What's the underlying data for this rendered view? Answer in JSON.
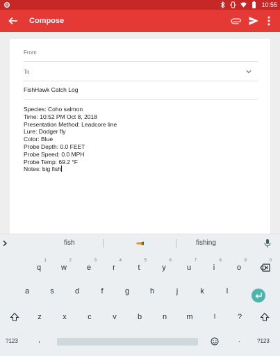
{
  "status_bar": {
    "time": "10:55",
    "icons": [
      "settings-icon",
      "bluetooth-icon",
      "vibrate-icon",
      "wifi-icon",
      "battery-icon"
    ]
  },
  "app_bar": {
    "title": "Compose",
    "icons": [
      "back-arrow-icon",
      "paperclip-icon",
      "send-icon",
      "more-vert-icon"
    ]
  },
  "compose": {
    "from_label": "From",
    "to_label": "To",
    "subject": "FishHawk Catch Log",
    "body_lines": [
      "Species: Coho salmon",
      "Time: 10:52 PM Oct 8, 2018",
      "Presentation Method: Leadcore line",
      "Lure: Dodger fly",
      "Color: Blue",
      "Probe Depth: 0.0 FEET",
      "Probe Speed: 0.0 MPH",
      "Probe Temp: 69.2 °F",
      "Notes: big fish"
    ]
  },
  "suggestions": {
    "left": "fish",
    "right": "fishing"
  },
  "keyboard": {
    "row1": [
      {
        "label": "q",
        "hint": "1"
      },
      {
        "label": "w",
        "hint": "2"
      },
      {
        "label": "e",
        "hint": "3"
      },
      {
        "label": "r",
        "hint": "4"
      },
      {
        "label": "t",
        "hint": "5"
      },
      {
        "label": "y",
        "hint": "6"
      },
      {
        "label": "u",
        "hint": "7"
      },
      {
        "label": "i",
        "hint": "8"
      },
      {
        "label": "o",
        "hint": "9"
      },
      {
        "label": "p",
        "hint": "0"
      }
    ],
    "row2": [
      "a",
      "s",
      "d",
      "f",
      "g",
      "h",
      "j",
      "k",
      "l"
    ],
    "row3": [
      "z",
      "x",
      "c",
      "v",
      "b",
      "n",
      "m",
      "!",
      "?"
    ],
    "bottom": {
      "symbols_left": "?123",
      "comma": ",",
      "period": ".",
      "symbols_right": "?123"
    },
    "accent_color": "#4db6ac"
  },
  "colors": {
    "app_bar": "#e53935",
    "status_bar": "#c62828"
  }
}
